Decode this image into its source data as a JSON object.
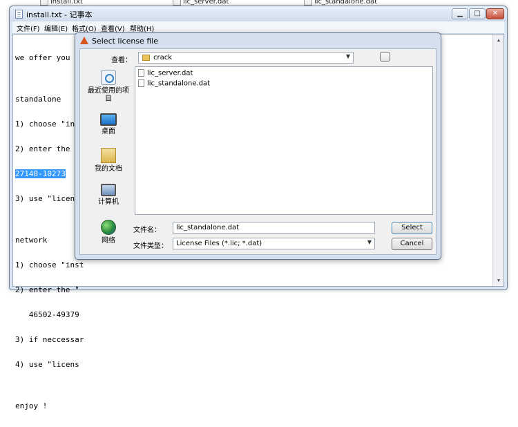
{
  "background_files": [
    "install.txt",
    "lic_server.dat",
    "lic_standalone.dat"
  ],
  "notepad": {
    "title": "install.txt - 记事本",
    "menu": [
      "文件(F)",
      "编辑(E)",
      "格式(O)",
      "查看(V)",
      "帮助(H)"
    ],
    "lines": [
      "we offer you tw",
      "",
      "standalone",
      "1) choose \"inst",
      "2) enter the \"",
      "27148-10273",
      "3) use \"licens",
      "",
      "network",
      "1) choose \"inst",
      "2) enter the \"",
      "   46502-49379",
      "3) if neccessar",
      "4) use \"licens",
      "",
      "enjoy !"
    ],
    "highlighted_line": "27148-10273"
  },
  "dialog": {
    "title": "Select license file",
    "look_in_label": "查看：",
    "look_in_value": "crack",
    "places": [
      {
        "label": "最近使用的项\n目",
        "icon": "recent-items-icon"
      },
      {
        "label": "桌面",
        "icon": "desktop-icon"
      },
      {
        "label": "我的文档",
        "icon": "documents-folder-icon"
      },
      {
        "label": "计算机",
        "icon": "computer-icon"
      },
      {
        "label": "网络",
        "icon": "network-icon"
      }
    ],
    "files": [
      "lic_server.dat",
      "lic_standalone.dat"
    ],
    "filename_label": "文件名：",
    "filename_value": "lic_standalone.dat",
    "filetype_label": "文件类型：",
    "filetype_value": "License Files (*.lic; *.dat)",
    "select_label": "Select",
    "cancel_label": "Cancel"
  }
}
